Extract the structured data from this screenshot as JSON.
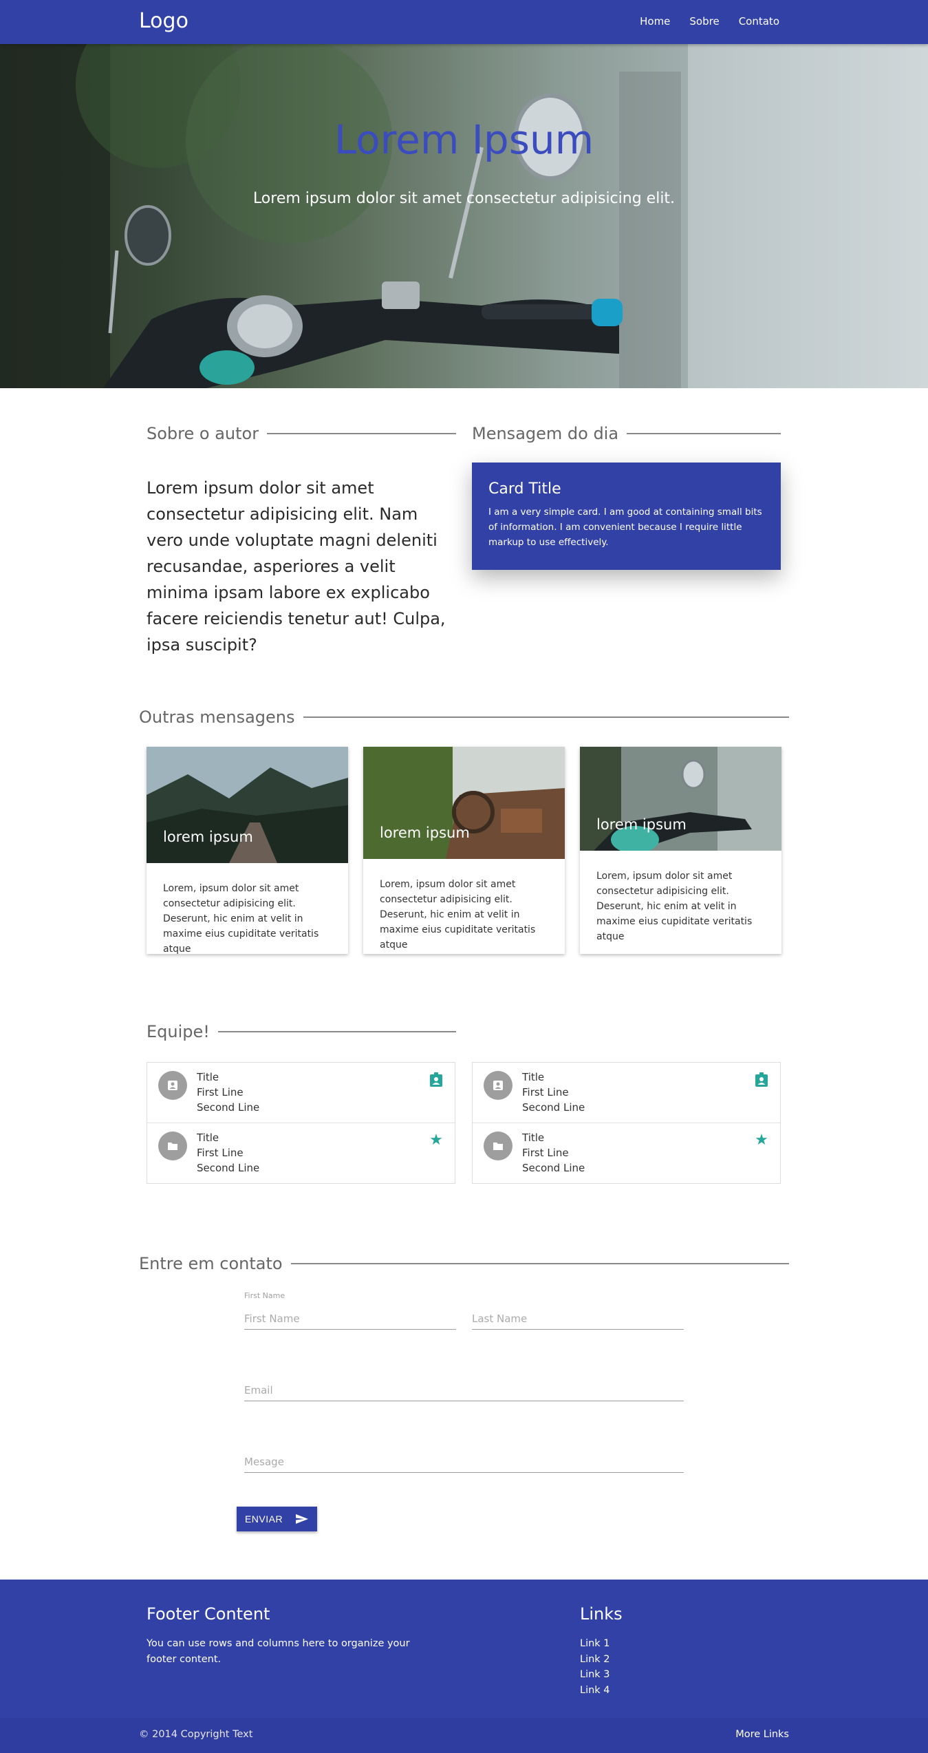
{
  "nav": {
    "logo": "Logo",
    "links": [
      "Home",
      "Sobre",
      "Contato"
    ]
  },
  "hero": {
    "title": "Lorem Ipsum",
    "subtitle": "Lorem ipsum dolor sit amet consectetur adipisicing elit."
  },
  "about": {
    "heading": "Sobre o autor",
    "text": "Lorem ipsum dolor sit amet consectetur adipisicing elit. Nam vero unde voluptate magni deleniti recusandae, asperiores a velit minima ipsam labore ex explicabo facere reiciendis tenetur aut! Culpa, ipsa suscipit?"
  },
  "message_day": {
    "heading": "Mensagem do dia",
    "card_title": "Card Title",
    "card_body": "I am a very simple card. I am good at containing small bits of information. I am convenient because I require little markup to use effectively."
  },
  "other_messages": {
    "heading": "Outras mensagens",
    "cards": [
      {
        "caption": "lorem ipsum",
        "text": "Lorem, ipsum dolor sit amet consectetur adipisicing elit. Deserunt, hic enim at velit in maxime eius cupiditate veritatis atque"
      },
      {
        "caption": "lorem ipsum",
        "text": "Lorem, ipsum dolor sit amet consectetur adipisicing elit. Deserunt, hic enim at velit in maxime eius cupiditate veritatis atque"
      },
      {
        "caption": "lorem ipsum",
        "text": "Lorem, ipsum dolor sit amet consectetur adipisicing elit. Deserunt, hic enim at velit in maxime eius cupiditate veritatis atque"
      }
    ]
  },
  "team": {
    "heading": "Equipe!",
    "boxes": [
      {
        "rows": [
          {
            "title": "Title",
            "line1": "First Line",
            "line2": "Second Line",
            "avatar_icon": "account-box-icon",
            "action_icon": "contact-badge-icon"
          },
          {
            "title": "Title",
            "line1": "First Line",
            "line2": "Second Line",
            "avatar_icon": "folder-icon",
            "action_icon": "star-icon"
          }
        ]
      },
      {
        "rows": [
          {
            "title": "Title",
            "line1": "First Line",
            "line2": "Second Line",
            "avatar_icon": "account-box-icon",
            "action_icon": "contact-badge-icon"
          },
          {
            "title": "Title",
            "line1": "First Line",
            "line2": "Second Line",
            "avatar_icon": "folder-icon",
            "action_icon": "star-icon"
          }
        ]
      }
    ]
  },
  "contact": {
    "heading": "Entre em contato",
    "first_name_label": "First Name",
    "first_name_placeholder": "First Name",
    "last_name_placeholder": "Last Name",
    "email_placeholder": "Email",
    "message_placeholder": "Mesage",
    "send_label": "ENVIAR"
  },
  "footer": {
    "title": "Footer Content",
    "text": "You can use rows and columns here to organize your footer content.",
    "links_title": "Links",
    "links": [
      "Link 1",
      "Link 2",
      "Link 3",
      "Link 4"
    ],
    "copyright": "© 2014 Copyright Text",
    "more_links": "More Links"
  },
  "colors": {
    "primary": "#3241a6",
    "accent": "#26a69a",
    "hero_title": "#3a4cbe"
  }
}
